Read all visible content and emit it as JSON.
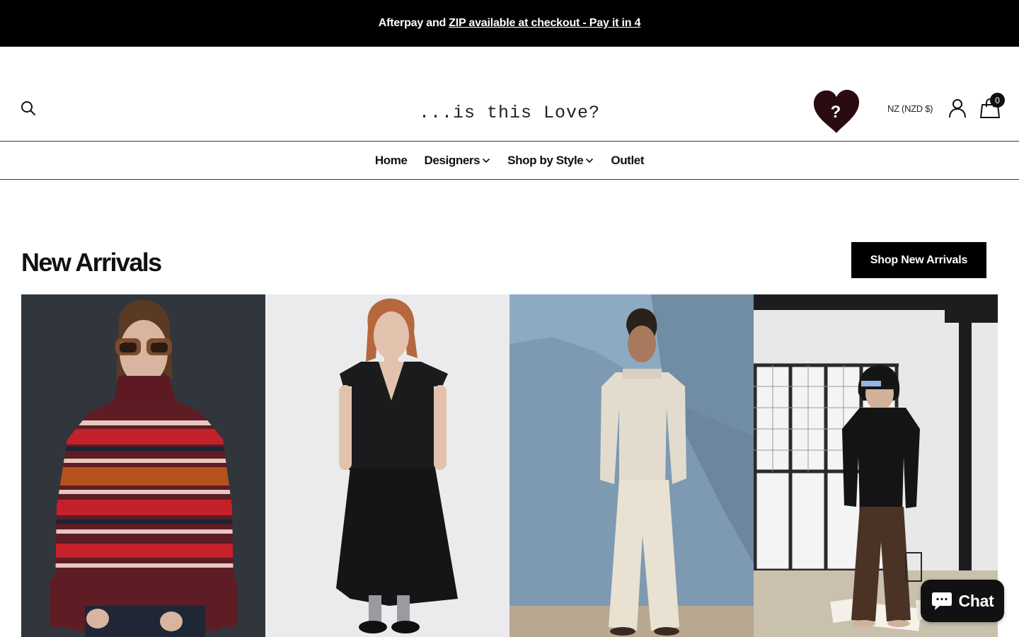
{
  "announcement": {
    "text": "Afterpay and",
    "link_text": "ZIP available at checkout - Pay it in 4"
  },
  "header": {
    "logo_text": "...is this Love?",
    "heart_badge_text": "?",
    "currency": "NZ (NZD $)",
    "cart_count": "0",
    "icons": [
      "search-icon",
      "heart-logo-icon",
      "account-icon",
      "cart-icon"
    ]
  },
  "nav": {
    "items": [
      {
        "label": "Home",
        "has_dropdown": false
      },
      {
        "label": "Designers",
        "has_dropdown": true
      },
      {
        "label": "Shop by Style",
        "has_dropdown": true
      },
      {
        "label": "Outlet",
        "has_dropdown": false
      }
    ]
  },
  "new_arrivals": {
    "title": "New Arrivals",
    "button_label": "Shop New Arrivals",
    "products": [
      {
        "image": "striped-knit-turtleneck-sweater-photo"
      },
      {
        "image": "black-sleeveless-top-and-skirt-photo"
      },
      {
        "image": "cream-shirt-and-wide-trousers-photo"
      },
      {
        "image": "black-hoodie-brown-trousers-photo"
      }
    ]
  },
  "chat": {
    "label": "Chat",
    "icon": "chat-bubble-icon"
  },
  "colors": {
    "announcement_bg": "#000000",
    "nav_border": "#4b2c55",
    "heart": "#2a0b10",
    "button_bg": "#000000"
  }
}
